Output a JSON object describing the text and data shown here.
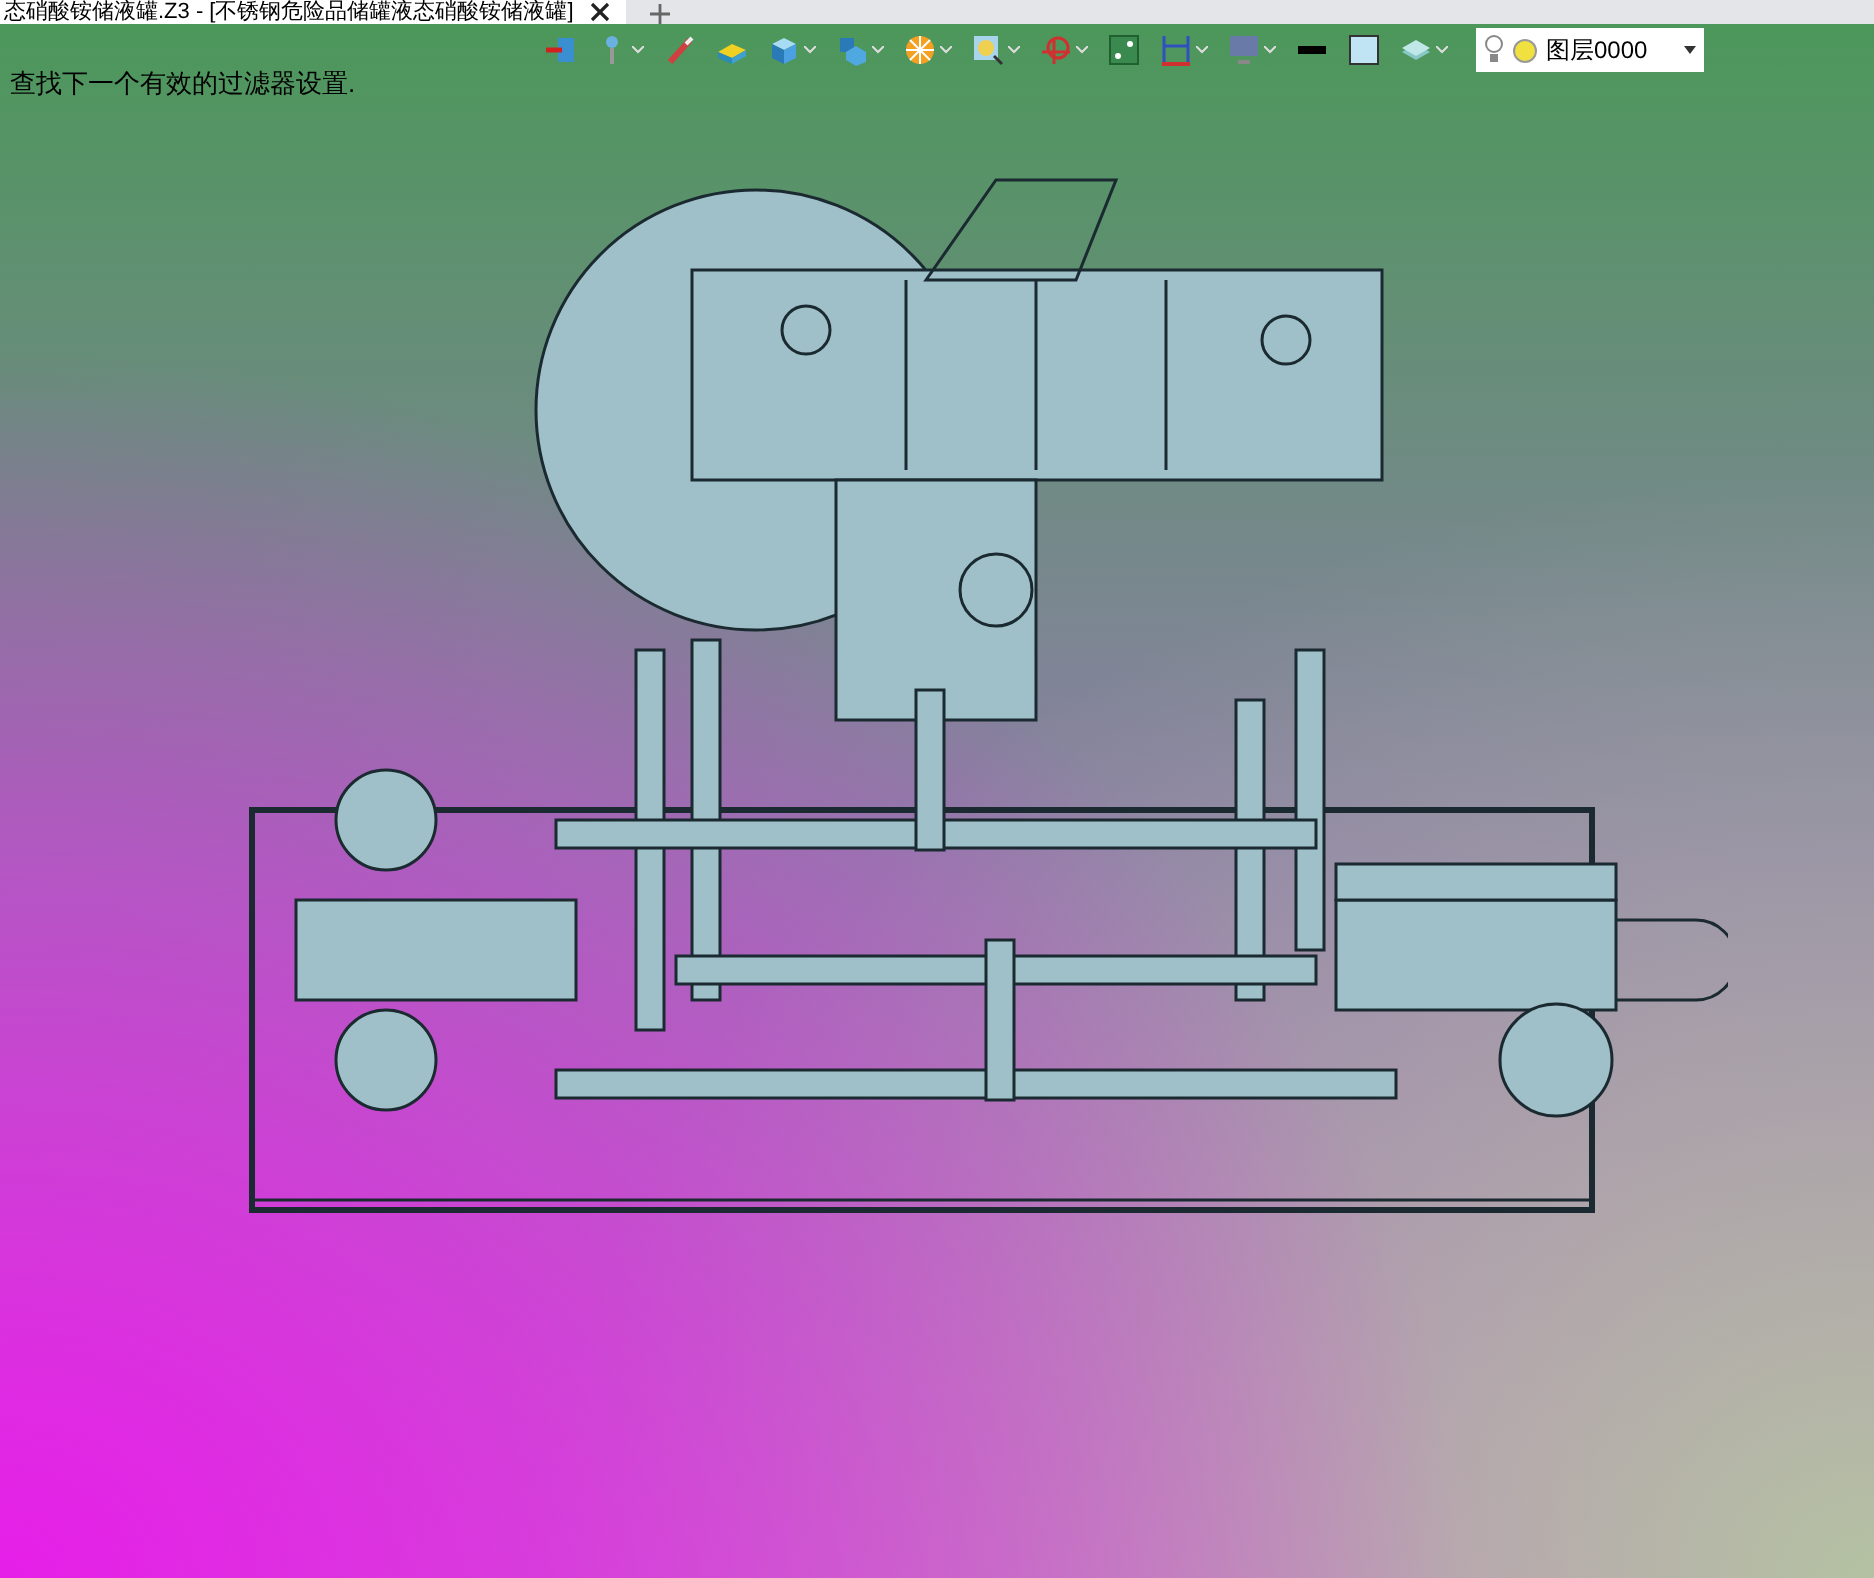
{
  "tab": {
    "title": "态硝酸铵储液罐.Z3 - [不锈钢危险品储罐液态硝酸铵储液罐]",
    "selected": true
  },
  "toolbar": [
    {
      "kind": "exit",
      "dropdown": false
    },
    {
      "kind": "pin",
      "dropdown": true
    },
    {
      "kind": "brush",
      "dropdown": false
    },
    {
      "kind": "slab",
      "dropdown": false
    },
    {
      "kind": "cube",
      "dropdown": true
    },
    {
      "kind": "view",
      "dropdown": true
    },
    {
      "kind": "wheel",
      "dropdown": true
    },
    {
      "kind": "zoom",
      "dropdown": true
    },
    {
      "kind": "axis",
      "dropdown": true
    },
    {
      "kind": "frame",
      "dropdown": false
    },
    {
      "kind": "dimension",
      "dropdown": true
    },
    {
      "kind": "monitor",
      "dropdown": true
    },
    {
      "kind": "line",
      "dropdown": false
    },
    {
      "kind": "fill",
      "dropdown": false
    },
    {
      "kind": "layers",
      "dropdown": true
    }
  ],
  "layer_select": {
    "value": "图层0000"
  },
  "message": "查找下一个有效的过滤器设置."
}
